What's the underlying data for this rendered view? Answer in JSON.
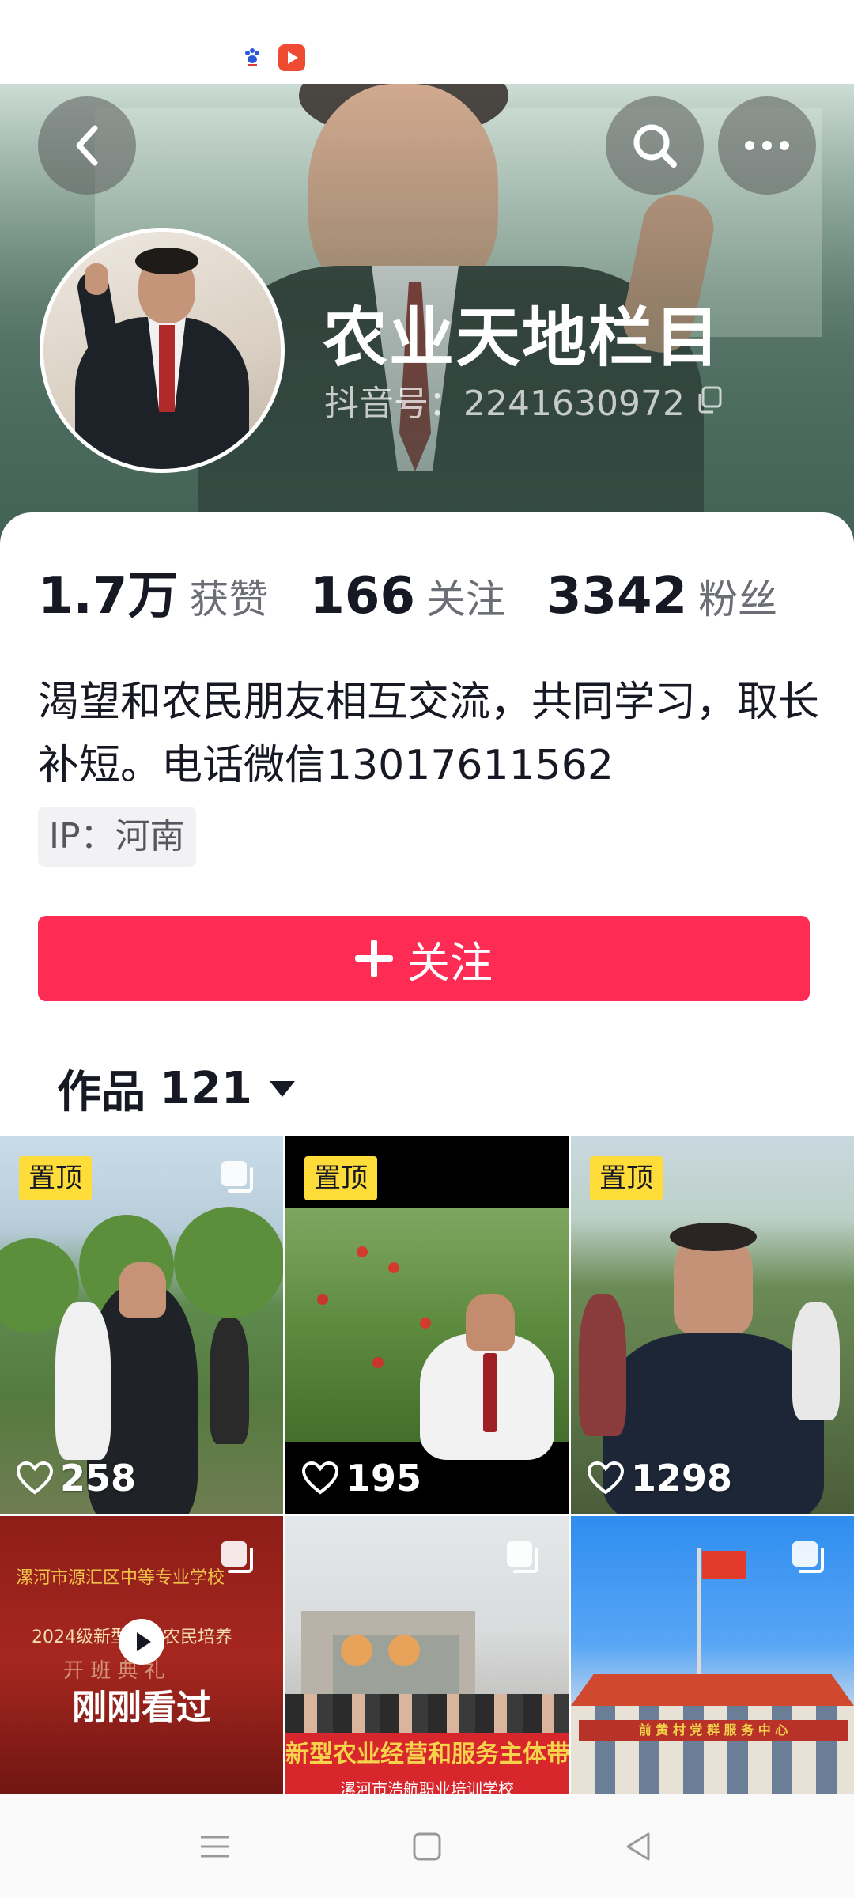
{
  "status_bar": {
    "icons": [
      "baidu-icon",
      "video-app-icon"
    ]
  },
  "header": {
    "buttons": [
      "back",
      "search",
      "more"
    ]
  },
  "profile": {
    "name": "农业天地栏目",
    "id_label": "抖音号：2241630972",
    "stats": [
      {
        "value": "1.7万",
        "label": "获赞"
      },
      {
        "value": "166",
        "label": "关注"
      },
      {
        "value": "3342",
        "label": "粉丝"
      }
    ],
    "bio": "渴望和农民朋友相互交流，共同学习，取长补短。电话微信13017611562",
    "ip": "IP：河南",
    "follow_label": "关注"
  },
  "works": {
    "label": "作品",
    "count": "121"
  },
  "videos": [
    {
      "pinned": "置顶",
      "likes": "258"
    },
    {
      "pinned": "置顶",
      "likes": "195"
    },
    {
      "pinned": "置顶",
      "likes": "1298"
    },
    {
      "overlay": "刚刚看过",
      "banner_top": "漯河市源汇区中等专业学校",
      "banner_mid": "2024级新型职业农民培养",
      "banner_bottom": "开 班 典 礼"
    },
    {
      "banner": "新型农业经营和服务主体带头",
      "sub": "漯河市浩航职业培训学校"
    },
    {
      "sign": "前 黄 村 党 群 服 务 中 心"
    }
  ],
  "colors": {
    "primary": "#fe2c55",
    "pin": "#fedc3a",
    "text": "#161823"
  }
}
